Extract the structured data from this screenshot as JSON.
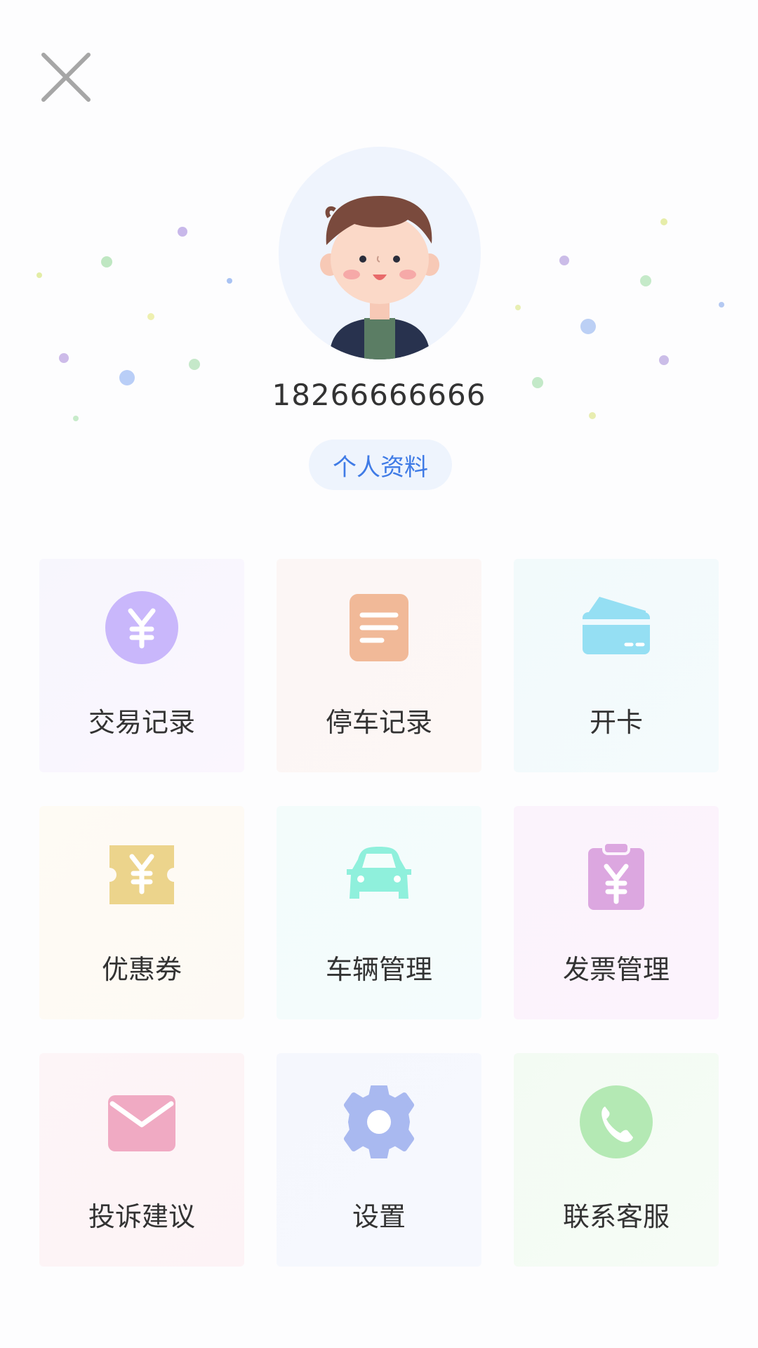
{
  "header": {
    "close_icon": "close-icon"
  },
  "profile": {
    "avatar_icon": "boy-avatar-illustration",
    "phone": "18266666666",
    "edit_label": "个人资料"
  },
  "menu": {
    "items": [
      {
        "label": "交易记录",
        "icon": "yuan-circle-icon",
        "color": "#c9b7fb"
      },
      {
        "label": "停车记录",
        "icon": "document-icon",
        "color": "#f1b998"
      },
      {
        "label": "开卡",
        "icon": "card-icon",
        "color": "#95dff3"
      },
      {
        "label": "优惠券",
        "icon": "coupon-icon",
        "color": "#ecd48c"
      },
      {
        "label": "车辆管理",
        "icon": "car-icon",
        "color": "#8ff0dc"
      },
      {
        "label": "发票管理",
        "icon": "invoice-clipboard-icon",
        "color": "#dca7e0"
      },
      {
        "label": "投诉建议",
        "icon": "envelope-icon",
        "color": "#f0aac3"
      },
      {
        "label": "设置",
        "icon": "gear-icon",
        "color": "#a9b9f0"
      },
      {
        "label": "联系客服",
        "icon": "phone-icon",
        "color": "#b4e9b4"
      }
    ]
  }
}
